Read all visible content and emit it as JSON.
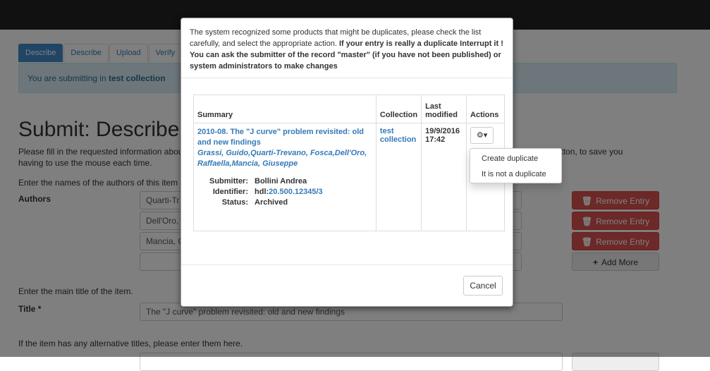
{
  "tabs": [
    "Describe",
    "Describe",
    "Upload",
    "Verify"
  ],
  "alert": {
    "prefix": "You are submitting in ",
    "collection": "test collection"
  },
  "page": {
    "title": "Submit: Describe",
    "instructions_line1": "Please fill in the requested information about",
    "instructions_line2": "having to use the mouse each time.",
    "instructions_right": "ox or button, to save you",
    "authors_help": "Enter the names of the authors of this item in",
    "authors_label": "Authors",
    "authors": [
      "Quarti-Tr",
      "Dell'Oro,",
      "Mancia, G",
      ""
    ],
    "remove_label": "Remove Entry",
    "add_more_label": "Add More",
    "title_help": "Enter the main title of the item.",
    "title_label": "Title *",
    "title_value": "The \"J curve\" problem revisited: old and new findings",
    "alt_title_help": "If the item has any alternative titles, please enter them here."
  },
  "modal": {
    "intro_normal": "The system recognized some products that might be duplicates, please check the list carefully, and select the appropriate action. ",
    "intro_bold": "If your entry is really a duplicate Interrupt it ! You can ask the submitter of the record \"master\" (if you have not been published) or system administrators to make changes",
    "columns": {
      "summary": "Summary",
      "collection": "Collection",
      "last_modified_1": "Last",
      "last_modified_2": "modified",
      "actions": "Actions"
    },
    "row": {
      "title": "2010-08. The \"J curve\" problem revisited: old and new findings",
      "authors": "Grassi, Guido,Quarti-Trevano, Fosca,Dell'Oro, Raffaella,Mancia, Giuseppe",
      "submitter_label": "Submitter:",
      "submitter": "Bollini Andrea",
      "identifier_label": "Identifier:",
      "identifier_prefix": "hdl:",
      "identifier_num": "20.500.12345/3",
      "status_label": "Status:",
      "status": "Archived",
      "collection": "test collection",
      "modified_date": "19/9/2016",
      "modified_time": "17:42"
    },
    "dropdown": [
      "Create duplicate",
      "It is not a duplicate"
    ],
    "cancel_label": "Cancel"
  },
  "icons": {
    "gear": "gear-icon",
    "trash": "trash-icon",
    "plus": "plus-icon",
    "caret": "caret-down-icon"
  },
  "colors": {
    "primary": "#428bca",
    "link": "#337ab7",
    "danger": "#d9534f",
    "info_bg": "#d9edf7",
    "topbar": "#222222"
  }
}
